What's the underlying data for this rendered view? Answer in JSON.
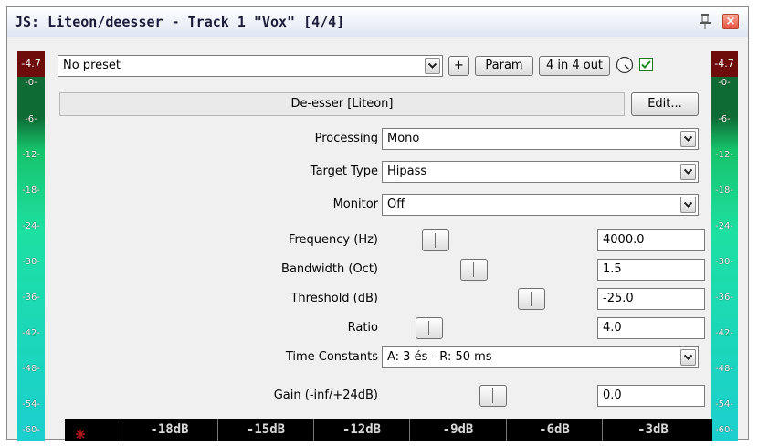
{
  "window": {
    "title": "JS: Liteon/deesser - Track 1 \"Vox\" [4/4]",
    "close_glyph": "×"
  },
  "toolbar": {
    "preset": "No preset",
    "add_label": "+",
    "param_label": "Param",
    "io_label": "4 in 4 out",
    "enabled_checked": true
  },
  "plugin": {
    "name": "De-esser [Liteon]",
    "edit_label": "Edit..."
  },
  "meters": {
    "left": {
      "peak": "-4.7",
      "ticks": [
        "-0-",
        "-6-",
        "-12-",
        "-18-",
        "-24-",
        "-30-",
        "-36-",
        "-42-",
        "-48-",
        "-54-",
        "-60-"
      ]
    },
    "right": {
      "peak": "-4.7",
      "ticks": [
        "-0-",
        "-6-",
        "-12-",
        "-18-",
        "-24-",
        "-30-",
        "-36-",
        "-42-",
        "-48-",
        "-54-",
        "-60-"
      ]
    }
  },
  "params": {
    "processing": {
      "label": "Processing",
      "value": "Mono"
    },
    "target_type": {
      "label": "Target Type",
      "value": "Hipass"
    },
    "monitor": {
      "label": "Monitor",
      "value": "Off"
    },
    "frequency": {
      "label": "Frequency (Hz)",
      "value": "4000.0",
      "slider_fraction": 0.19
    },
    "bandwidth": {
      "label": "Bandwidth (Oct)",
      "value": "1.5",
      "slider_fraction": 0.41
    },
    "threshold": {
      "label": "Threshold (dB)",
      "value": "-25.0",
      "slider_fraction": 0.74
    },
    "ratio": {
      "label": "Ratio",
      "value": "4.0",
      "slider_fraction": 0.15
    },
    "time_constants": {
      "label": "Time Constants",
      "value": "A: 3 és - R: 50 ms"
    },
    "gain": {
      "label": "Gain (-inf/+24dB)",
      "value": "0.0",
      "slider_fraction": 0.52
    }
  },
  "scale": {
    "labels": [
      "-18dB",
      "-15dB",
      "-12dB",
      "-9dB",
      "-6dB",
      "-3dB"
    ],
    "marker_color": "#b01818"
  },
  "colors": {
    "meter_peak": "#6e0c0c",
    "meter_top": "#0e6b33",
    "meter_bottom": "#1ccfcf"
  }
}
